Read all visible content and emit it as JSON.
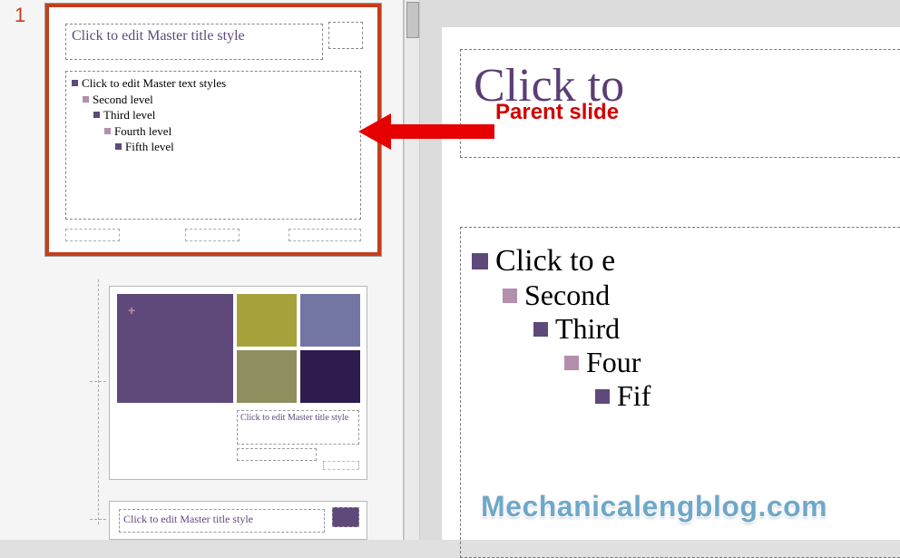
{
  "slide_number": "1",
  "annotation_label": "Parent slide",
  "watermark": "Mechanicalengblog.com",
  "master": {
    "title": "Click to edit Master title style",
    "levels": [
      "Click to edit Master text styles",
      "Second level",
      "Third level",
      "Fourth level",
      "Fifth level"
    ]
  },
  "layout2": {
    "title": "Click to edit Master title style"
  },
  "layout3": {
    "title": "Click to edit Master title style"
  },
  "editor": {
    "title_fragment": "Click to",
    "levels": [
      "Click to e",
      "Second",
      "Third",
      "Four",
      "Fif"
    ]
  }
}
